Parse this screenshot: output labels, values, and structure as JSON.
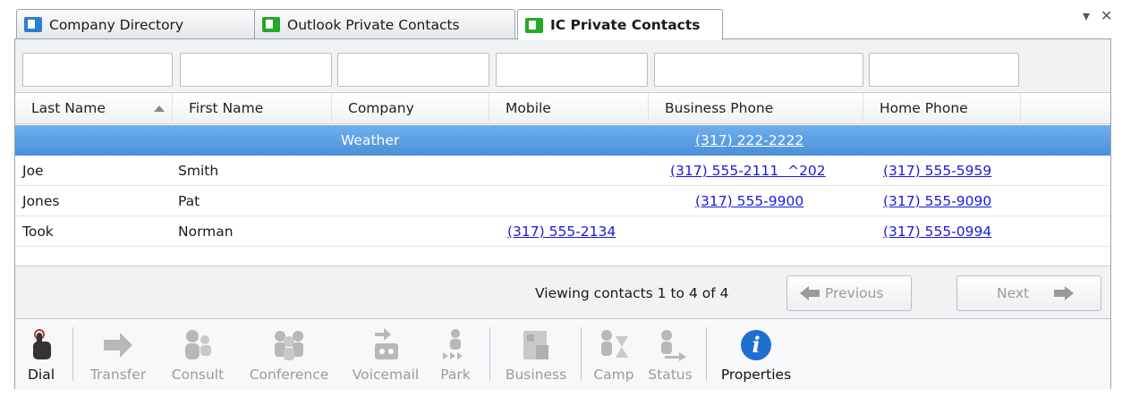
{
  "tabs": [
    {
      "label": "Company Directory",
      "active": false,
      "icon": "contact-card-blue-icon"
    },
    {
      "label": "Outlook Private Contacts",
      "active": false,
      "icon": "contact-card-green-icon"
    },
    {
      "label": "IC Private Contacts",
      "active": true,
      "icon": "contact-card-green-icon"
    }
  ],
  "window_controls": {
    "menu": "▾",
    "close": "✕"
  },
  "filters": [
    "",
    "",
    "",
    "",
    "",
    ""
  ],
  "columns": [
    "Last Name",
    "First Name",
    "Company",
    "Mobile",
    "Business Phone",
    "Home Phone"
  ],
  "sort": {
    "column": "Last Name",
    "direction": "ascending"
  },
  "rows": [
    {
      "last": "",
      "first": "",
      "company": "Weather",
      "mobile": "",
      "business": "(317) 222-2222",
      "home": "",
      "selected": true
    },
    {
      "last": "Joe",
      "first": "Smith",
      "company": "",
      "mobile": "",
      "business": "(317) 555-2111  ^202",
      "home": "(317) 555-5959",
      "selected": false
    },
    {
      "last": "Jones",
      "first": "Pat",
      "company": "",
      "mobile": "",
      "business": "(317) 555-9900",
      "home": "(317) 555-9090",
      "selected": false
    },
    {
      "last": "Took",
      "first": "Norman",
      "company": "",
      "mobile": "(317) 555-2134",
      "business": "",
      "home": "(317) 555-0994",
      "selected": false
    }
  ],
  "status": {
    "viewing": "Viewing contacts 1 to 4 of 4",
    "previous_label": "Previous",
    "next_label": "Next"
  },
  "toolbar": [
    {
      "label": "Dial",
      "icon": "dial-hand-icon",
      "enabled": true
    },
    {
      "label": "Transfer",
      "icon": "transfer-arrow-icon",
      "enabled": false
    },
    {
      "label": "Consult",
      "icon": "consult-icon",
      "enabled": false
    },
    {
      "label": "Conference",
      "icon": "conference-icon",
      "enabled": false
    },
    {
      "label": "Voicemail",
      "icon": "voicemail-icon",
      "enabled": false
    },
    {
      "label": "Park",
      "icon": "park-icon",
      "enabled": false
    },
    {
      "label": "Business",
      "icon": "business-card-icon",
      "enabled": false
    },
    {
      "label": "Camp",
      "icon": "camp-hourglass-icon",
      "enabled": false
    },
    {
      "label": "Status",
      "icon": "status-icon",
      "enabled": false
    },
    {
      "label": "Properties",
      "icon": "info-icon",
      "enabled": true
    }
  ],
  "colors": {
    "selection": "#4a90d9",
    "link": "#1a1adb",
    "tab_icon_green": "#25a82a",
    "tab_icon_blue": "#2c7fd0",
    "info_blue": "#1f6fd0"
  }
}
